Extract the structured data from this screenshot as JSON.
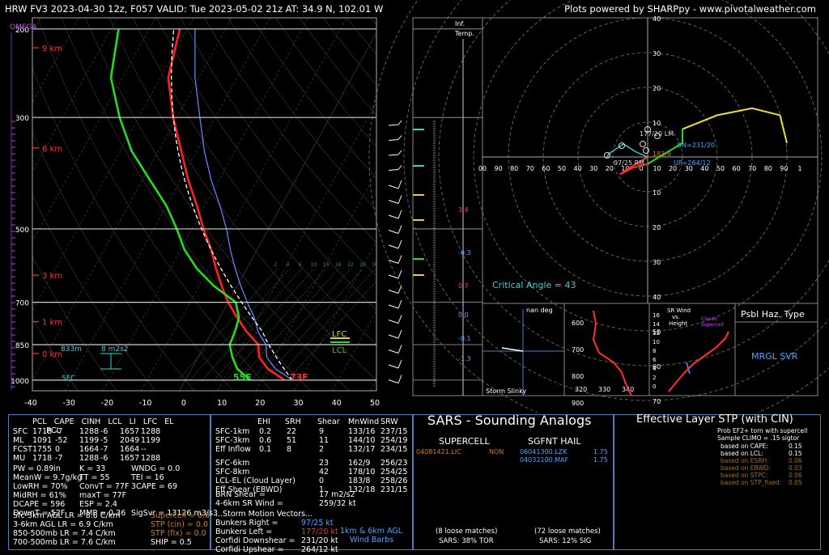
{
  "header": {
    "left": "HRW FV3 2023-04-30 12z, F057  VALID: Tue 2023-05-02 21z  AT: 34.9 N, 102.01 W",
    "right": "Plots powered by SHARPpy - www.pivotalweather.com"
  },
  "skewt": {
    "omega_label": "OMEGA",
    "pressure_ticks": [
      {
        "p": 200,
        "label": "200"
      },
      {
        "p": 300,
        "label": "300"
      },
      {
        "p": 500,
        "label": "500"
      },
      {
        "p": 700,
        "label": "700"
      },
      {
        "p": 850,
        "label": "850"
      },
      {
        "p": 1000,
        "label": "1000"
      }
    ],
    "temp_ticks": [
      "-40",
      "-30",
      "-20",
      "-10",
      "0",
      "10",
      "20",
      "30",
      "40",
      "50"
    ],
    "height_labels": [
      {
        "p": 218,
        "label": "9 km"
      },
      {
        "p": 345,
        "label": "6 km"
      },
      {
        "p": 618,
        "label": "3 km"
      },
      {
        "p": 765,
        "label": "1 km"
      },
      {
        "p": 885,
        "label": "0 km"
      }
    ],
    "annotations": {
      "h833": "833m",
      "srh": "8 m2s2",
      "sfc": "SFC",
      "td_sfc": "55F",
      "t_sfc": "73F",
      "lfc": "LFC",
      "lcl": "LCL"
    },
    "mixing_ratio_labels": [
      "2",
      "4",
      "6",
      "10",
      "14",
      "16",
      "22",
      "26",
      "30",
      "34"
    ],
    "colors": {
      "temp": "#ff2020",
      "dewp": "#22dd22",
      "parcel": "#ffffff",
      "virtual": "#6a8cff",
      "omega": "#cc44ff"
    }
  },
  "inf_temp": {
    "label_top": "Inf.",
    "label_bottom": "Temp.",
    "values": [
      "3.4",
      "-0.3",
      "0.7",
      "0.0",
      "-0.1",
      "-1.3"
    ]
  },
  "hodograph": {
    "rings": [
      "10",
      "20",
      "30",
      "40",
      "50",
      "60",
      "70",
      "80"
    ],
    "x_labels": [
      "00",
      "90",
      "80",
      "70",
      "60",
      "50",
      "40",
      "30",
      "20",
      "10",
      "0",
      "10",
      "20",
      "30",
      "40",
      "50",
      "60",
      "70",
      "80",
      "90",
      "1"
    ],
    "labels": {
      "lm": "177/20 LM",
      "dn": "DN=231/20",
      "rm": "97/25 RM",
      "up": "UP=264/12",
      "val1838": "183/8",
      "crit": "Critical Angle = 43"
    }
  },
  "small_panels": {
    "slinky_title": "Storm Slinky",
    "nan_deg": "nan deg",
    "theta_y": [
      "600",
      "700",
      "800",
      "900"
    ],
    "theta_x": [
      "320",
      "330",
      "340"
    ],
    "srwind_title": "SR Wind\nvs.\nHeight",
    "classic_sc": "Classic\nSupercell",
    "srwind_y": [
      "16",
      "14",
      "12",
      "10",
      "8",
      "6",
      "4",
      "2",
      "0"
    ],
    "srwind_x": [
      "0",
      "20",
      "40",
      "60",
      "80"
    ],
    "psbl_title": "Psbl Haz. Type",
    "psbl_value": "MRGL SVR"
  },
  "params": {
    "header": [
      "PCL",
      "CAPE",
      "CINH",
      "LCL",
      "LI",
      "LFC",
      "EL"
    ],
    "rows": [
      [
        "SFC",
        "1718",
        "-7",
        "1288",
        "-6",
        "1657",
        "1288"
      ],
      [
        "ML",
        "1091",
        "-52",
        "1199",
        "-5",
        "2049",
        "1199"
      ],
      [
        "FCST",
        "1755",
        "0",
        "1664",
        "-7",
        "1664",
        "--"
      ],
      [
        "MU",
        "1718",
        "-7",
        "1288",
        "-6",
        "1657",
        "1288"
      ]
    ],
    "col2": [
      [
        "PW = 0.89in",
        "K = 33",
        "WNDG = 0.0"
      ],
      [
        "MeanW = 9.7g/kg",
        "TT = 55",
        "TEI = 16"
      ],
      [
        "LowRH = 70%",
        "ConvT = 77F",
        "3CAPE = 69"
      ],
      [
        "MidRH = 61%",
        "maxT = 77F",
        ""
      ],
      [
        "DCAPE = 596",
        "ESP = 2.4",
        ""
      ],
      [
        "DownT = 52F",
        "MMP = 0.36",
        "SigSvr = 13126 m3/s3"
      ]
    ],
    "lapse": [
      "Sfc-3km AGL LR = 8.8 C/km",
      "3-6km AGL LR = 6.9 C/km",
      "850-500mb LR = 7.4 C/km",
      "700-500mb LR = 7.6 C/km"
    ],
    "comp": [
      {
        "label": "Supercell = 0.0",
        "color": "#d08020"
      },
      {
        "label": "STP (cin) = 0.0",
        "color": "#d08020"
      },
      {
        "label": "STP (fix) = 0.0",
        "color": "#d08020"
      },
      {
        "label": "SHIP = 0.5",
        "color": "#ffffff"
      }
    ]
  },
  "kinematics": {
    "header": [
      "EHI",
      "SRH",
      "Shear",
      "MnWind",
      "SRW"
    ],
    "rows": [
      [
        "SFC-1km",
        "0.2",
        "22",
        "9",
        "133/16",
        "237/15"
      ],
      [
        "SFC-3km",
        "0.6",
        "51",
        "11",
        "144/10",
        "254/19"
      ],
      [
        "Eff Inflow",
        "0.1",
        "8",
        "2",
        "132/17",
        "234/15"
      ],
      [
        "SFC-6km",
        "",
        "",
        "23",
        "162/9",
        "256/23"
      ],
      [
        "SFC-8km",
        "",
        "",
        "42",
        "178/10",
        "254/25"
      ],
      [
        "LCL-EL (Cloud Layer)",
        "",
        "",
        "0",
        "183/8",
        "258/26"
      ],
      [
        "Eff Shear (EBWD)",
        "",
        "",
        "1",
        "132/18",
        "231/15"
      ]
    ],
    "brn": [
      "BRN Shear =",
      "17 m2/s2"
    ],
    "sr46": [
      "4-6km SR Wind =",
      "259/32 kt"
    ],
    "motion_title": "...Storm Motion Vectors...",
    "motion": [
      {
        "k": "Bunkers Right =",
        "v": "97/25 kt",
        "color": "#4aa6ff"
      },
      {
        "k": "Bunkers Left =",
        "v": "177/20 kt",
        "color": "#ff3030"
      },
      {
        "k": "Corfidi Downshear =",
        "v": "231/20 kt",
        "color": "#ffffff"
      },
      {
        "k": "Corfidi Upshear =",
        "v": "264/12 kt",
        "color": "#ffffff"
      }
    ],
    "barbs_label": "1km & 6km AGL\nWind Barbs"
  },
  "sars": {
    "title": "SARS - Sounding Analogs",
    "supercell": "SUPERCELL",
    "sgfnt": "SGFNT HAIL",
    "sc_match": {
      "id": "04081421.LIC",
      "type": "NON"
    },
    "hail_matches": [
      {
        "id": "06041300.LZK",
        "val": "1.75"
      },
      {
        "id": "04032100.MAF",
        "val": "1.75"
      }
    ],
    "sc_loose": "(8 loose matches)",
    "sc_pct": "SARS: 38% TOR",
    "hail_loose": "(72 loose matches)",
    "hail_pct": "SARS: 12% SIG"
  },
  "stp": {
    "title": "Effective Layer STP (with CIN)",
    "legend_title": "Prob EF2+ torn with supercell",
    "legend_sub": "Sample CLIMO = .15 sigtor",
    "legend": [
      {
        "k": "based on CAPE:",
        "v": "0.15",
        "color": "#ffffff"
      },
      {
        "k": "based on LCL:",
        "v": "0.15",
        "color": "#ffffff"
      },
      {
        "k": "based on ESRH:",
        "v": "0.06",
        "color": "#a07020"
      },
      {
        "k": "based on EBWD:",
        "v": "0.03",
        "color": "#a07020"
      },
      {
        "k": "based on STPC:",
        "v": "0.06",
        "color": "#a07020"
      },
      {
        "k": "based on STP_fixed:",
        "v": "0.05",
        "color": "#a07020"
      }
    ],
    "y_ticks": [
      "0",
      "1",
      "2",
      "3",
      "4",
      "5",
      "6",
      "7",
      "8",
      "9",
      "10",
      "11"
    ],
    "categories": [
      "EF4+",
      "EF3",
      "EF2",
      "EF1",
      "EF0",
      "NONTOR"
    ]
  },
  "chart_data": {
    "type": "line",
    "title": "HRW FV3 2023-04-30 12z, F057  VALID: Tue 2023-05-02 21z  AT: 34.9 N, 102.01 W",
    "xlabel": "",
    "ylabel": "",
    "xlim": [
      -40,
      50
    ],
    "ylim": [
      1000,
      100
    ],
    "series": [
      {
        "points": [
          [
            1000,
            26
          ],
          [
            950,
            20
          ],
          [
            900,
            16
          ],
          [
            850,
            14
          ],
          [
            800,
            9
          ],
          [
            750,
            4.5
          ],
          [
            700,
            0
          ],
          [
            650,
            -4
          ],
          [
            600,
            -8
          ],
          [
            550,
            -12
          ],
          [
            500,
            -17
          ],
          [
            450,
            -22
          ],
          [
            400,
            -28
          ],
          [
            350,
            -34
          ],
          [
            300,
            -41
          ],
          [
            250,
            -48
          ],
          [
            200,
            -52
          ]
        ]
      },
      {
        "points": [
          [
            1000,
            17
          ],
          [
            950,
            12
          ],
          [
            900,
            9
          ],
          [
            850,
            6.5
          ],
          [
            800,
            6
          ],
          [
            750,
            5
          ],
          [
            700,
            2
          ],
          [
            650,
            -6
          ],
          [
            600,
            -13
          ],
          [
            550,
            -19
          ],
          [
            500,
            -24
          ],
          [
            450,
            -30
          ],
          [
            400,
            -38
          ],
          [
            350,
            -47
          ],
          [
            300,
            -55
          ],
          [
            250,
            -63
          ],
          [
            200,
            -68
          ]
        ]
      },
      {
        "points": [
          [
            1000,
            28
          ],
          [
            950,
            22
          ],
          [
            900,
            18
          ],
          [
            850,
            16
          ],
          [
            800,
            12
          ],
          [
            750,
            9
          ],
          [
            700,
            5
          ],
          [
            650,
            1
          ],
          [
            600,
            -3
          ],
          [
            550,
            -7
          ],
          [
            500,
            -11
          ],
          [
            450,
            -16
          ],
          [
            400,
            -22
          ],
          [
            350,
            -28
          ],
          [
            300,
            -34
          ],
          [
            250,
            -41
          ],
          [
            200,
            -48
          ]
        ]
      }
    ],
    "hodograph_points": [
      [
        0,
        0
      ],
      [
        -5,
        -3
      ],
      [
        -8,
        -5
      ],
      [
        -4,
        -3
      ],
      [
        0,
        -2
      ],
      [
        5,
        1
      ],
      [
        10,
        4
      ],
      [
        10,
        8
      ],
      [
        20,
        12
      ],
      [
        30,
        14
      ],
      [
        38,
        12
      ],
      [
        40,
        4
      ]
    ],
    "stp_boxes": [
      {
        "cat": "EF4+",
        "min": 1.5,
        "q1": 2.5,
        "med": 5.5,
        "q3": 8.5,
        "max": 11
      },
      {
        "cat": "EF3",
        "min": 0.5,
        "q1": 1.5,
        "med": 2.8,
        "q3": 4.5,
        "max": 8.5
      },
      {
        "cat": "EF2",
        "min": 0.2,
        "q1": 1.0,
        "med": 2.0,
        "q3": 3.8,
        "max": 6.5
      },
      {
        "cat": "EF1",
        "min": 0.0,
        "q1": 0.5,
        "med": 1.3,
        "q3": 2.5,
        "max": 4.8
      },
      {
        "cat": "EF0",
        "min": 0.0,
        "q1": 0.4,
        "med": 0.9,
        "q3": 2.0,
        "max": 3.5
      },
      {
        "cat": "NONTOR",
        "min": 0.0,
        "q1": 0.0,
        "med": 0.2,
        "q3": 0.6,
        "max": 0.9
      }
    ]
  }
}
